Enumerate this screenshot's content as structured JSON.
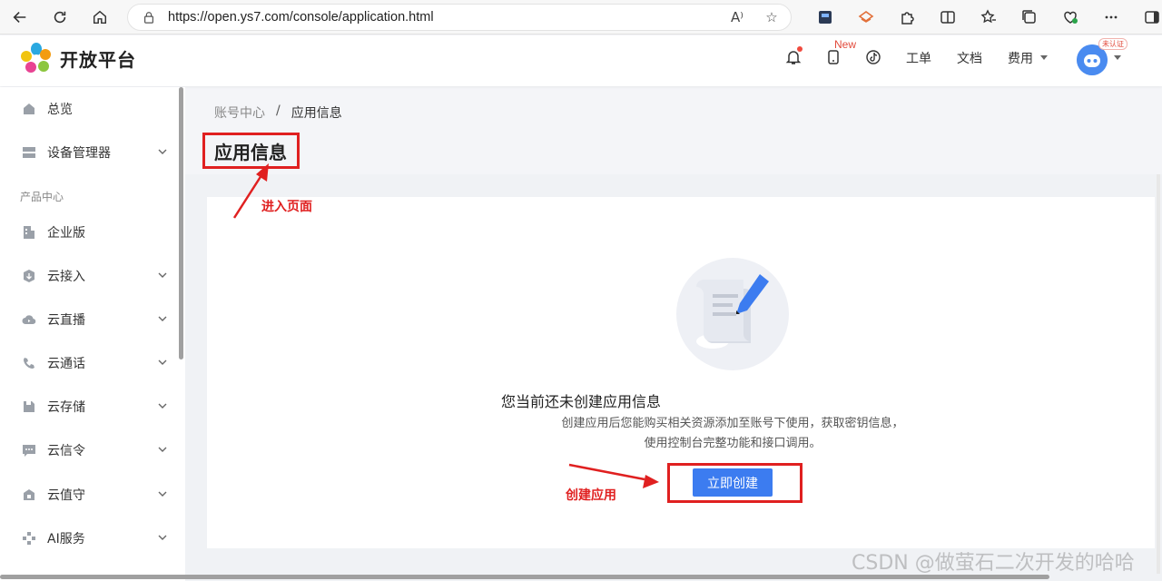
{
  "browser": {
    "url": "https://open.ys7.com/console/application.html"
  },
  "header": {
    "logo_text": "开放平台",
    "new_badge": "New",
    "work_order": "工单",
    "docs": "文档",
    "billing": "费用",
    "unverified_label": "未认证"
  },
  "sidebar": {
    "items": [
      {
        "label": "总览",
        "icon": "home-icon"
      },
      {
        "label": "设备管理器",
        "icon": "device-icon"
      },
      {
        "label": "企业版",
        "icon": "building-icon"
      },
      {
        "label": "云接入",
        "icon": "cloud-access-icon"
      },
      {
        "label": "云直播",
        "icon": "cloud-live-icon"
      },
      {
        "label": "云通话",
        "icon": "phone-icon"
      },
      {
        "label": "云存储",
        "icon": "storage-icon"
      },
      {
        "label": "云信令",
        "icon": "message-icon"
      },
      {
        "label": "云值守",
        "icon": "guard-icon"
      },
      {
        "label": "AI服务",
        "icon": "ai-icon"
      }
    ],
    "group_label": "产品中心"
  },
  "breadcrumb": {
    "parent": "账号中心",
    "separator": "/",
    "current": "应用信息"
  },
  "page": {
    "title": "应用信息",
    "empty_title": "您当前还未创建应用信息",
    "empty_desc": "创建应用后您能购买相关资源添加至账号下使用，获取密钥信息，使用控制台完整功能和接口调用。",
    "create_button": "立即创建"
  },
  "annotations": {
    "enter_page": "进入页面",
    "create_app": "创建应用"
  },
  "watermark": "CSDN @做萤石二次开发的哈哈",
  "colors": {
    "primary": "#3c7cf0",
    "annotation_red": "#e02020"
  }
}
